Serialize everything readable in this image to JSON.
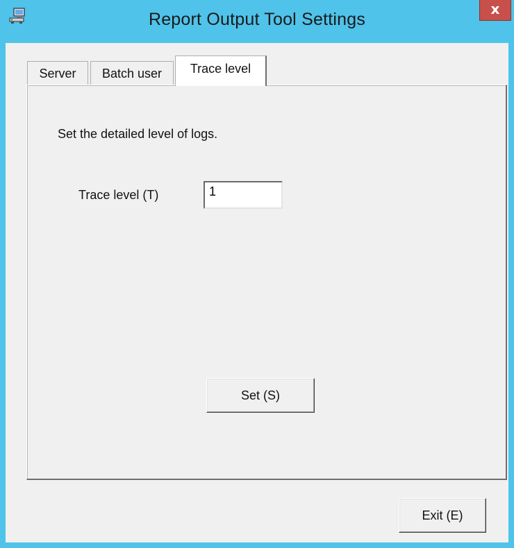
{
  "window": {
    "title": "Report Output Tool Settings",
    "close_label": "x",
    "app_icon": "computer-network-icon",
    "accent_color": "#4fc3ea",
    "close_color": "#c7504a"
  },
  "tabs": [
    {
      "label": "Server",
      "selected": false
    },
    {
      "label": "Batch user",
      "selected": false
    },
    {
      "label": "Trace level",
      "selected": true
    }
  ],
  "trace_panel": {
    "description": "Set the detailed level of logs.",
    "trace_level_label": "Trace level (T)",
    "trace_level_value": "1",
    "set_button_label": "Set (S)"
  },
  "footer": {
    "exit_button_label": "Exit (E)"
  }
}
